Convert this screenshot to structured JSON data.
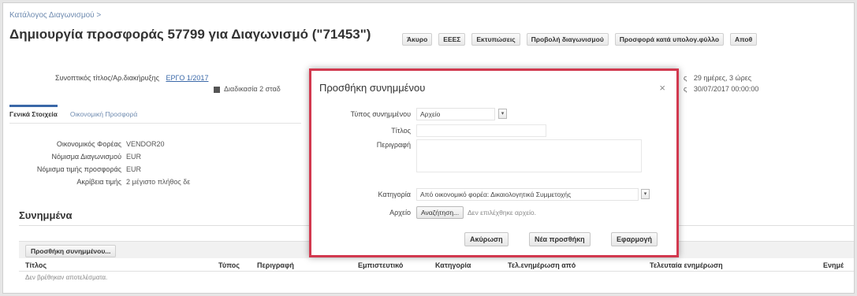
{
  "breadcrumb": "Κατάλογος Διαγωνισμού >",
  "page": {
    "title": "Δημιουργία προσφοράς 57799 για Διαγωνισμό (\"71453\")"
  },
  "toolbar": [
    "Άκυρο",
    "ΕΕΕΣ",
    "Εκτυπώσεις",
    "Προβολή διαγωνισμού",
    "Προσφορά κατά υπολογ.φύλλο",
    "Αποθ"
  ],
  "summary": {
    "label": "Συνοπτικός τίτλος/Αρ.διακήρυξης",
    "value": "ΕΡΓΟ 1/2017",
    "checkbox_label": "Διαδικασία 2 σταδ",
    "right1_label": "ς",
    "right1_value": "29 ημέρες, 3 ώρες",
    "right2_label": "ς",
    "right2_value": "30/07/2017 00:00:00"
  },
  "tabs": [
    "Γενικά Στοιχεία",
    "Οικονομική Προσφορά"
  ],
  "general": [
    {
      "k": "Οικονομικός Φορέας",
      "v": "VENDOR20"
    },
    {
      "k": "Νόμισμα Διαγωνισμού",
      "v": "EUR"
    },
    {
      "k": "Νόμισμα τιμής προσφοράς",
      "v": "EUR"
    },
    {
      "k": "Ακρίβεια τιμής",
      "v": "2 μέγιστο πλήθος δε"
    }
  ],
  "attachments": {
    "title": "Συνημμένα",
    "add_button": "Προσθήκη συνημμένου...",
    "columns": [
      "Τίτλος",
      "Τύπος",
      "Περιγραφή",
      "Εμπιστευτικό",
      "Κατηγορία",
      "Τελ.ενημέρωση από",
      "Τελευταία ενημέρωση",
      "Ενημέ"
    ],
    "empty_text": "Δεν βρέθηκαν αποτελέσματα."
  },
  "modal": {
    "title": "Προσθήκη συνημμένου",
    "close": "×",
    "type_label": "Τύπος συνημμένου",
    "type_value": "Αρχείο",
    "title_label": "Τίτλος",
    "desc_label": "Περιγραφή",
    "category_label": "Κατηγορία",
    "category_value": "Από οικονομικό φορέα: Δικαιολογητικά Συμμετοχής",
    "file_label": "Αρχείο",
    "browse_button": "Αναζήτηση...",
    "no_file": "Δεν επιλέχθηκε αρχείο.",
    "cancel": "Ακύρωση",
    "add_new": "Νέα προσθήκη",
    "apply": "Εφαρμογή"
  }
}
